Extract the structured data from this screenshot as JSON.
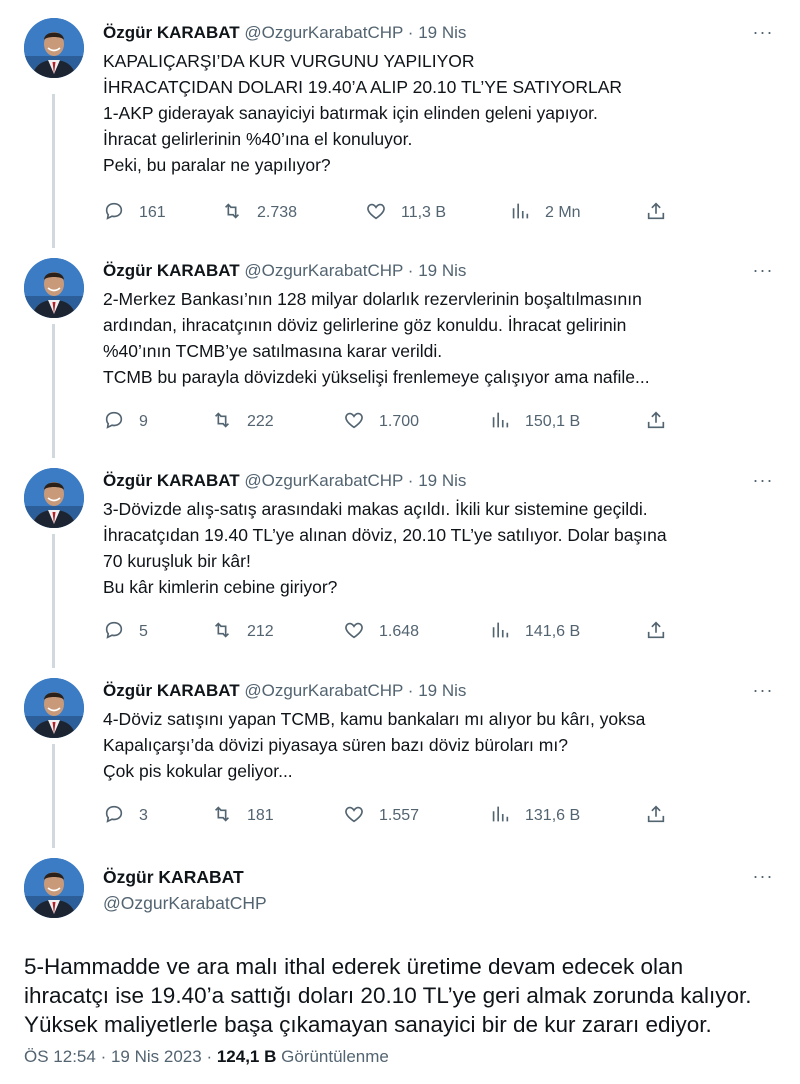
{
  "author": {
    "name": "Özgür KARABAT",
    "handle": "@OzgurKarabatCHP"
  },
  "tweets": [
    {
      "time": "19 Nis",
      "lines": [
        "KAPALIÇARŞI’DA KUR VURGUNU YAPILIYOR",
        "İHRACATÇIDAN DOLARI 19.40’A ALIP 20.10 TL’YE SATIYORLAR",
        "1-AKP giderayak sanayiciyi batırmak için elinden geleni yapıyor.",
        "İhracat gelirlerinin %40’ına el konuluyor.",
        "Peki, bu paralar ne yapılıyor?"
      ],
      "replies": "161",
      "retweets": "2.738",
      "likes": "11,3 B",
      "views": "2 Mn"
    },
    {
      "time": "19 Nis",
      "lines": [
        "2-Merkez Bankası’nın 128 milyar dolarlık rezervlerinin boşaltılmasının",
        "ardından, ihracatçının döviz gelirlerine göz konuldu. İhracat gelirinin",
        "%40’ının TCMB’ye satılmasına karar verildi.",
        "TCMB bu parayla dövizdeki yükselişi frenlemeye çalışıyor ama nafile..."
      ],
      "replies": "9",
      "retweets": "222",
      "likes": "1.700",
      "views": "150,1 B"
    },
    {
      "time": "19 Nis",
      "lines": [
        "3-Dövizde alış-satış arasındaki makas açıldı. İkili kur sistemine geçildi.",
        "İhracatçıdan 19.40 TL’ye alınan döviz, 20.10 TL’ye satılıyor. Dolar başına",
        "70 kuruşluk bir kâr!",
        "Bu kâr kimlerin cebine giriyor?"
      ],
      "replies": "5",
      "retweets": "212",
      "likes": "1.648",
      "views": "141,6 B"
    },
    {
      "time": "19 Nis",
      "lines": [
        "4-Döviz satışını yapan TCMB, kamu bankaları mı alıyor bu kârı, yoksa",
        "Kapalıçarşı’da dövizi piyasaya süren bazı döviz büroları mı?",
        "Çok pis kokular geliyor..."
      ],
      "replies": "3",
      "retweets": "181",
      "likes": "1.557",
      "views": "131,6 B"
    }
  ],
  "focus": {
    "lines": [
      "5-Hammadde ve ara malı ithal ederek üretime devam edecek olan",
      "ihracatçı ise 19.40’a sattığı doları 20.10 TL’ye geri almak zorunda kalıyor.",
      "Yüksek maliyetlerle başa çıkamayan sanayici bir de kur zararı ediyor."
    ],
    "time": "ÖS 12:54",
    "date": "19 Nis 2023",
    "views_count": "124,1 B",
    "views_label": "Görüntülenme"
  },
  "separator": "·",
  "more_glyph": "···",
  "colors": {
    "text": "#0f1419",
    "secondary": "#536471",
    "thread_line": "#cfd9de",
    "avatar_bg": "#2a6fb8"
  }
}
